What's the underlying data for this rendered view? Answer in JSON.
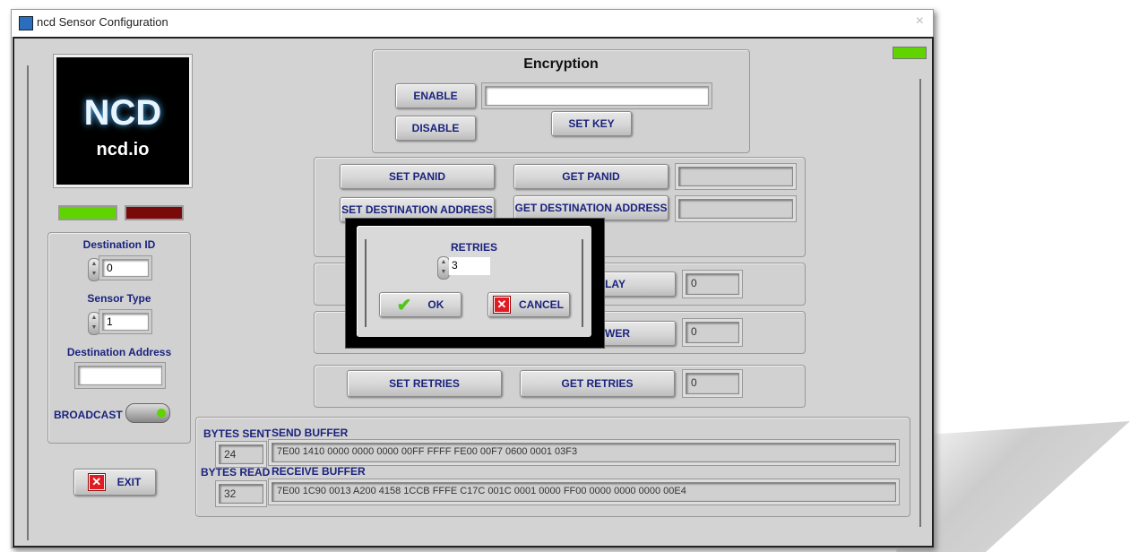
{
  "window": {
    "title": "ncd Sensor Configuration",
    "close": "×"
  },
  "logo": {
    "text": "NCD",
    "site": "ncd.io"
  },
  "indicators": {
    "status_top_right": "#5fd400",
    "led_green": "#5fd400",
    "led_red": "#7a0a0a"
  },
  "left": {
    "destination_id_label": "Destination ID",
    "destination_id": "0",
    "sensor_type_label": "Sensor Type",
    "sensor_type": "1",
    "destination_address_label": "Destination Address",
    "destination_address": "",
    "broadcast_label": "BROADCAST",
    "exit": "EXIT"
  },
  "encryption": {
    "title": "Encryption",
    "enable": "ENABLE",
    "disable": "DISABLE",
    "key": "",
    "set_key": "SET KEY"
  },
  "panid": {
    "set_panid": "SET PANID",
    "get_panid": "GET PANID",
    "panid_value": "",
    "set_dest": "SET DESTINATION ADDRESS",
    "get_dest": "GET DESTINATION ADDRESS",
    "dest_value": ""
  },
  "delay": {
    "partial_label": "LAY",
    "value": "0"
  },
  "power": {
    "partial_label": "WER",
    "value": "0"
  },
  "retries": {
    "set": "SET RETRIES",
    "get": "GET RETRIES",
    "value": "0"
  },
  "buffers": {
    "bytes_sent_label": "BYTES SENT",
    "bytes_sent": "24",
    "send_label": "SEND BUFFER",
    "send": "7E00 1410 0000 0000 0000 00FF FFFF FE00 00F7 0600 0001 03F3",
    "bytes_read_label": "BYTES READ",
    "bytes_read": "32",
    "receive_label": "RECEIVE BUFFER",
    "receive": "7E00 1C90 0013 A200 4158 1CCB FFFE C17C 001C 0001 0000 FF00 0000 0000 0000 00E4"
  },
  "dialog": {
    "label": "RETRIES",
    "value": "3",
    "ok": "OK",
    "cancel": "CANCEL"
  }
}
